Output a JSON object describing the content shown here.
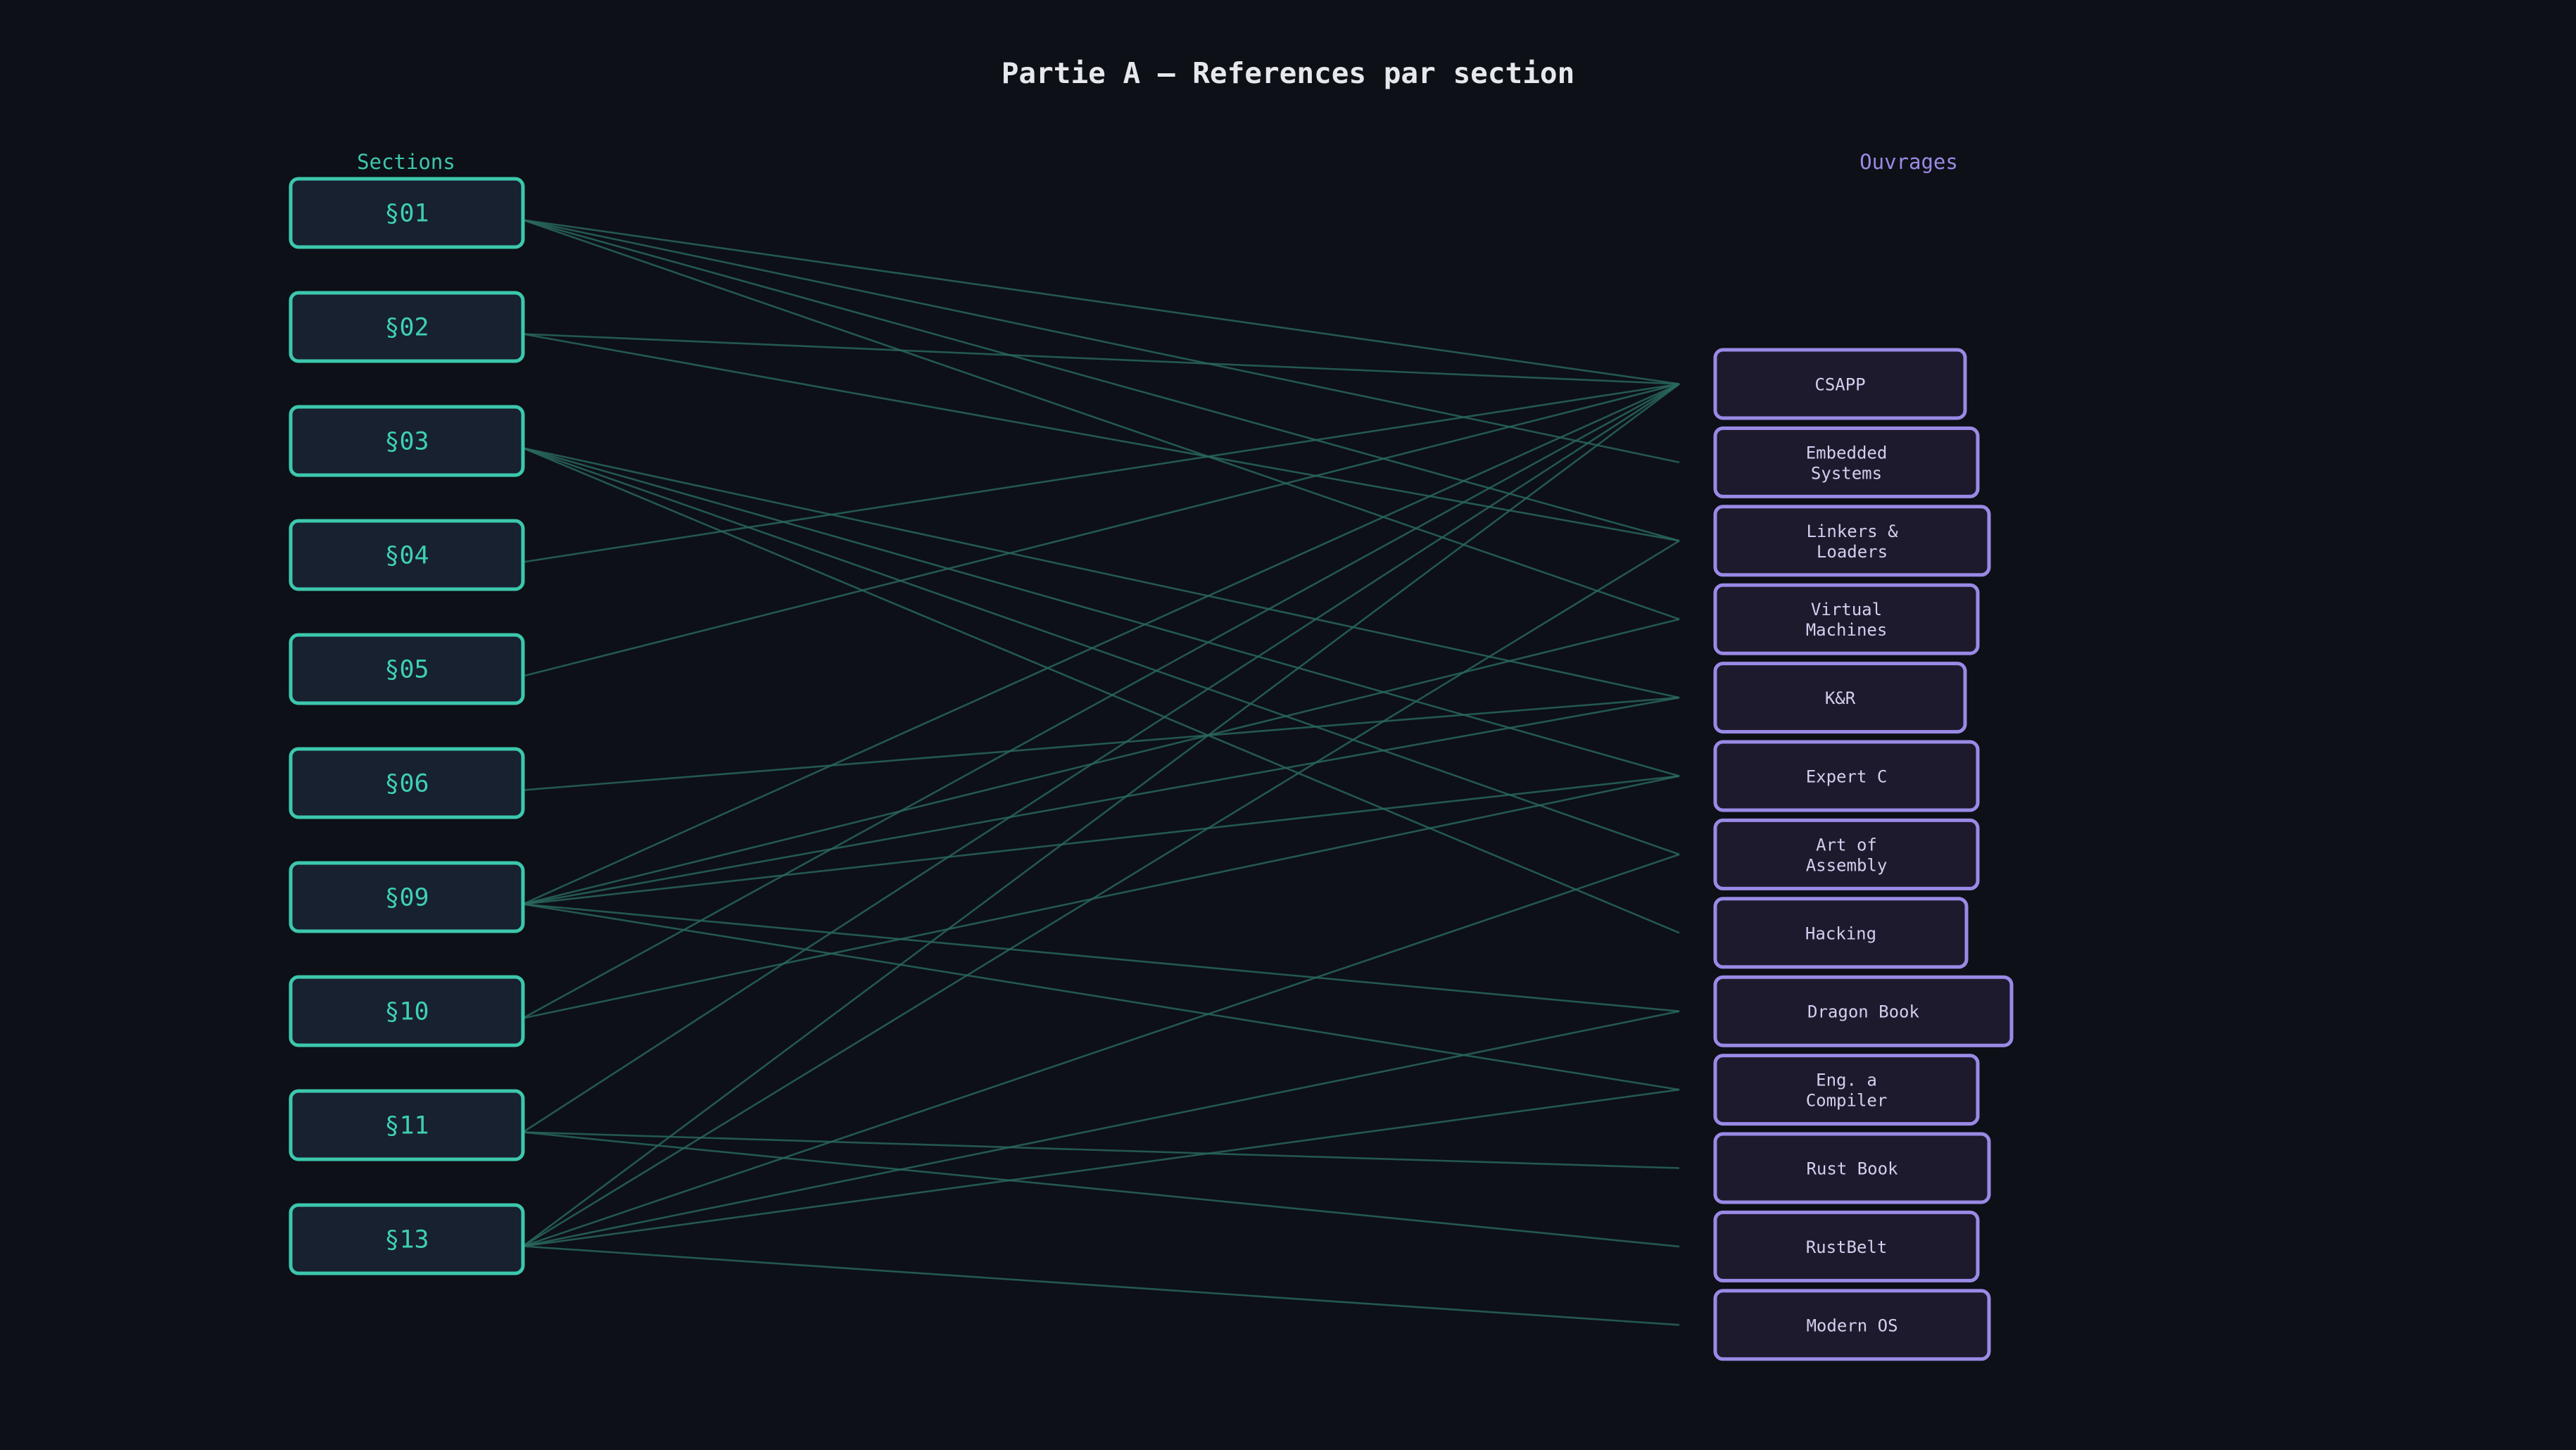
{
  "title": "Partie A — References par section",
  "columns": {
    "left": "Sections",
    "right": "Ouvrages"
  },
  "colors": {
    "background": "#0d1017",
    "section_accent": "#3cc8ad",
    "book_accent": "#9a8ae6",
    "link": "#2a6a5e"
  },
  "sections": [
    {
      "id": "s01",
      "label": "§01"
    },
    {
      "id": "s02",
      "label": "§02"
    },
    {
      "id": "s03",
      "label": "§03"
    },
    {
      "id": "s04",
      "label": "§04"
    },
    {
      "id": "s05",
      "label": "§05"
    },
    {
      "id": "s06",
      "label": "§06"
    },
    {
      "id": "s09",
      "label": "§09"
    },
    {
      "id": "s10",
      "label": "§10"
    },
    {
      "id": "s11",
      "label": "§11"
    },
    {
      "id": "s13",
      "label": "§13"
    }
  ],
  "books": [
    {
      "id": "csapp",
      "lines": [
        "CSAPP"
      ]
    },
    {
      "id": "embedded",
      "lines": [
        "Embedded",
        "Systems"
      ]
    },
    {
      "id": "linkers",
      "lines": [
        "Linkers &",
        "Loaders"
      ]
    },
    {
      "id": "vm",
      "lines": [
        "Virtual",
        "Machines"
      ]
    },
    {
      "id": "kr",
      "lines": [
        "K&R"
      ]
    },
    {
      "id": "expertc",
      "lines": [
        "Expert C"
      ]
    },
    {
      "id": "assembly",
      "lines": [
        "Art of",
        "Assembly"
      ]
    },
    {
      "id": "hacking",
      "lines": [
        "Hacking"
      ]
    },
    {
      "id": "dragon",
      "lines": [
        "Dragon Book"
      ]
    },
    {
      "id": "engcomp",
      "lines": [
        "Eng. a",
        "Compiler"
      ]
    },
    {
      "id": "rustbook",
      "lines": [
        "Rust Book"
      ]
    },
    {
      "id": "rustbelt",
      "lines": [
        "RustBelt"
      ]
    },
    {
      "id": "modernos",
      "lines": [
        "Modern OS"
      ]
    }
  ],
  "links": [
    [
      "s01",
      "csapp"
    ],
    [
      "s01",
      "embedded"
    ],
    [
      "s01",
      "linkers"
    ],
    [
      "s01",
      "vm"
    ],
    [
      "s02",
      "csapp"
    ],
    [
      "s02",
      "linkers"
    ],
    [
      "s03",
      "kr"
    ],
    [
      "s03",
      "expertc"
    ],
    [
      "s03",
      "assembly"
    ],
    [
      "s03",
      "hacking"
    ],
    [
      "s04",
      "csapp"
    ],
    [
      "s05",
      "csapp"
    ],
    [
      "s06",
      "kr"
    ],
    [
      "s09",
      "csapp"
    ],
    [
      "s09",
      "vm"
    ],
    [
      "s09",
      "kr"
    ],
    [
      "s09",
      "expertc"
    ],
    [
      "s09",
      "dragon"
    ],
    [
      "s09",
      "engcomp"
    ],
    [
      "s10",
      "expertc"
    ],
    [
      "s10",
      "csapp"
    ],
    [
      "s11",
      "csapp"
    ],
    [
      "s11",
      "rustbook"
    ],
    [
      "s11",
      "rustbelt"
    ],
    [
      "s13",
      "csapp"
    ],
    [
      "s13",
      "linkers"
    ],
    [
      "s13",
      "assembly"
    ],
    [
      "s13",
      "dragon"
    ],
    [
      "s13",
      "engcomp"
    ],
    [
      "s13",
      "modernos"
    ]
  ]
}
